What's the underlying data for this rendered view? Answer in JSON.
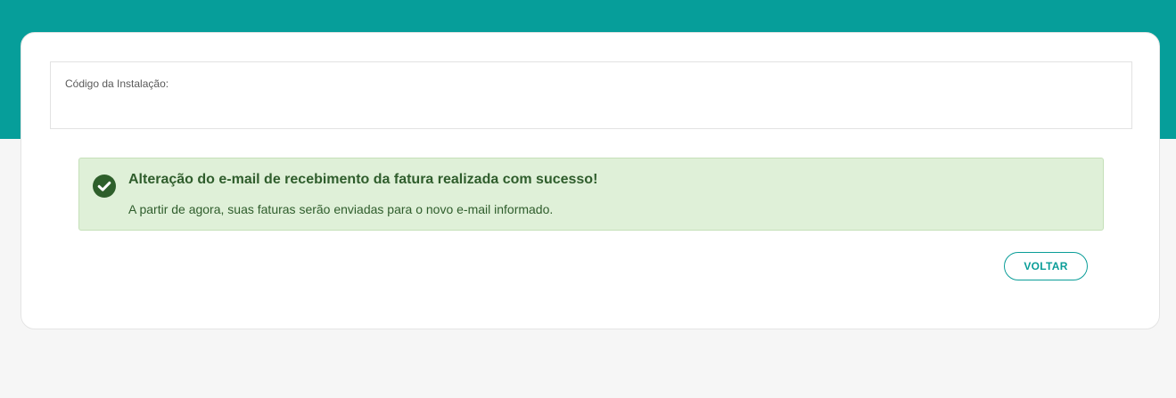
{
  "colors": {
    "header_band": "#069e9a",
    "page_background": "#f6f6f6",
    "success_background": "#dff0d8",
    "success_text": "#2f5d2c",
    "accent": "#0a9d98"
  },
  "installation": {
    "label": "Código da Instalação:",
    "value": ""
  },
  "alert": {
    "icon": "check-circle-icon",
    "title": "Alteração do e-mail de recebimento da fatura realizada com sucesso!",
    "message": "A partir de agora, suas faturas serão enviadas para o novo e-mail informado."
  },
  "actions": {
    "back_label": "VOLTAR"
  }
}
